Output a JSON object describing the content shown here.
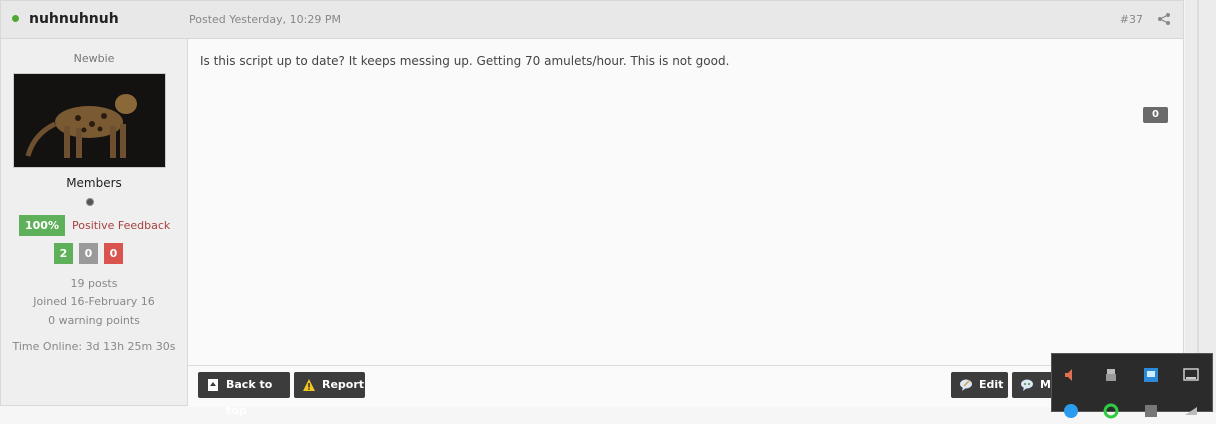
{
  "post": {
    "username": "nuhnuhnuh",
    "posted_label": "Posted Yesterday, 10:29 PM",
    "post_number": "#37",
    "body": "Is this script up to date? It keeps messing up. Getting 70 amulets/hour. This is not good.",
    "reputation": "0"
  },
  "author": {
    "rank": "Newbie",
    "group": "Members",
    "feedback_percent": "100%",
    "feedback_label": "Positive Feedback",
    "feedback_positive": "2",
    "feedback_neutral": "0",
    "feedback_negative": "0",
    "posts": "19 posts",
    "joined": "Joined 16-February 16",
    "warnings": "0 warning points",
    "time_online": "Time Online: 3d 13h 25m 30s"
  },
  "footer": {
    "back_to_top": "Back to top",
    "report": "Report",
    "edit": "Edit",
    "multiquote": "Mu"
  },
  "colors": {
    "online": "#4fa832",
    "positive": "#5fb05a",
    "neutral": "#9a9a9a",
    "negative": "#d9534f",
    "button": "#3c3c3c"
  },
  "icons": {
    "share": "share-icon",
    "back_to_top": "page-up-icon",
    "report": "warning-icon",
    "edit": "edit-bubble-icon",
    "multiquote": "multiquote-bubble-icon"
  }
}
